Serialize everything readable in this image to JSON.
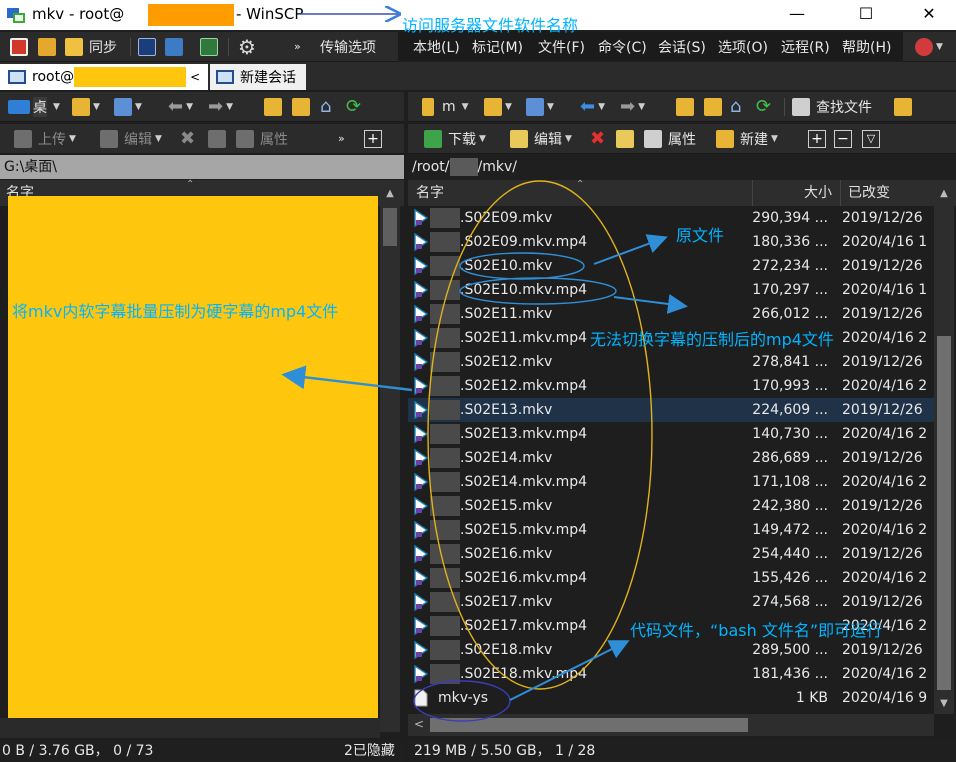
{
  "window": {
    "title_prefix": "mkv - root@",
    "title_suffix": "- WinSCP",
    "minimize": "—",
    "maximize": "☐",
    "close": "✕"
  },
  "toolbar": {
    "sync_label": "同步",
    "transfer_options_label": "传输选项"
  },
  "menu": {
    "items": [
      "本地(L)",
      "标记(M)",
      "文件(F)",
      "命令(C)",
      "会话(S)",
      "选项(O)",
      "远程(R)",
      "帮助(H)"
    ]
  },
  "tabs": {
    "session_label": "root@",
    "new_session_label": "新建会话"
  },
  "local": {
    "drive_label": "桌",
    "upload_label": "上传",
    "edit_label": "编辑",
    "properties_label": "属性",
    "path": "G:\\桌面\\",
    "col_name": "名字"
  },
  "remote": {
    "dir_label": "m",
    "find_label": "查找文件",
    "download_label": "下载",
    "edit_label": "编辑",
    "properties_label": "属性",
    "new_label": "新建",
    "path_prefix": "/root/",
    "path_suffix": "/mkv/",
    "col_name": "名字",
    "col_size": "大小",
    "col_changed": "已改变",
    "files": [
      {
        "name": ".S02E09.mkv",
        "size": "290,394 ...",
        "date": "2019/12/26"
      },
      {
        "name": ".S02E09.mkv.mp4",
        "size": "180,336 ...",
        "date": "2020/4/16 1"
      },
      {
        "name": ".S02E10.mkv",
        "size": "272,234 ...",
        "date": "2019/12/26"
      },
      {
        "name": ".S02E10.mkv.mp4",
        "size": "170,297 ...",
        "date": "2020/4/16 1"
      },
      {
        "name": ".S02E11.mkv",
        "size": "266,012 ...",
        "date": "2019/12/26"
      },
      {
        "name": ".S02E11.mkv.mp4",
        "size": "",
        "date": "2020/4/16 2"
      },
      {
        "name": ".S02E12.mkv",
        "size": "278,841 ...",
        "date": "2019/12/26"
      },
      {
        "name": ".S02E12.mkv.mp4",
        "size": "170,993 ...",
        "date": "2020/4/16 2"
      },
      {
        "name": ".S02E13.mkv",
        "size": "224,609 ...",
        "date": "2019/12/26"
      },
      {
        "name": ".S02E13.mkv.mp4",
        "size": "140,730 ...",
        "date": "2020/4/16 2"
      },
      {
        "name": ".S02E14.mkv",
        "size": "286,689 ...",
        "date": "2019/12/26"
      },
      {
        "name": ".S02E14.mkv.mp4",
        "size": "171,108 ...",
        "date": "2020/4/16 2"
      },
      {
        "name": ".S02E15.mkv",
        "size": "242,380 ...",
        "date": "2019/12/26"
      },
      {
        "name": ".S02E15.mkv.mp4",
        "size": "149,472 ...",
        "date": "2020/4/16 2"
      },
      {
        "name": ".S02E16.mkv",
        "size": "254,440 ...",
        "date": "2019/12/26"
      },
      {
        "name": ".S02E16.mkv.mp4",
        "size": "155,426 ...",
        "date": "2020/4/16 2"
      },
      {
        "name": ".S02E17.mkv",
        "size": "274,568 ...",
        "date": "2019/12/26"
      },
      {
        "name": ".S02E17.mkv.mp4",
        "size": "",
        "date": "2020/4/16 2"
      },
      {
        "name": ".S02E18.mkv",
        "size": "289,500 ...",
        "date": "2019/12/26"
      },
      {
        "name": ".S02E18.mkv.mp4",
        "size": "181,436 ...",
        "date": "2020/4/16 2"
      },
      {
        "name": "mkv-ys",
        "size": "1 KB",
        "date": "2020/4/16 9"
      }
    ]
  },
  "status": {
    "local_stats": "0 B / 3.76 GB，  0 / 73",
    "hidden": "2已隐藏",
    "remote_stats": "219 MB / 5.50 GB，  1 / 28"
  },
  "annotations": {
    "app_name": "访问服务器文件软件名称",
    "original_file": "原文件",
    "hard_sub": "无法切换字幕的压制后的mp4文件",
    "batch_note": "将mkv内软字幕批量压制为硬字幕的mp4文件",
    "script_note": "代码文件，“bash 文件名”即可运行"
  },
  "colors": {
    "highlight": "#fec70e",
    "annotation": "#00b4ff",
    "title_mask": "#fe9c00",
    "ellipse": "#e0b21b",
    "arrow": "#2f8fd6"
  }
}
